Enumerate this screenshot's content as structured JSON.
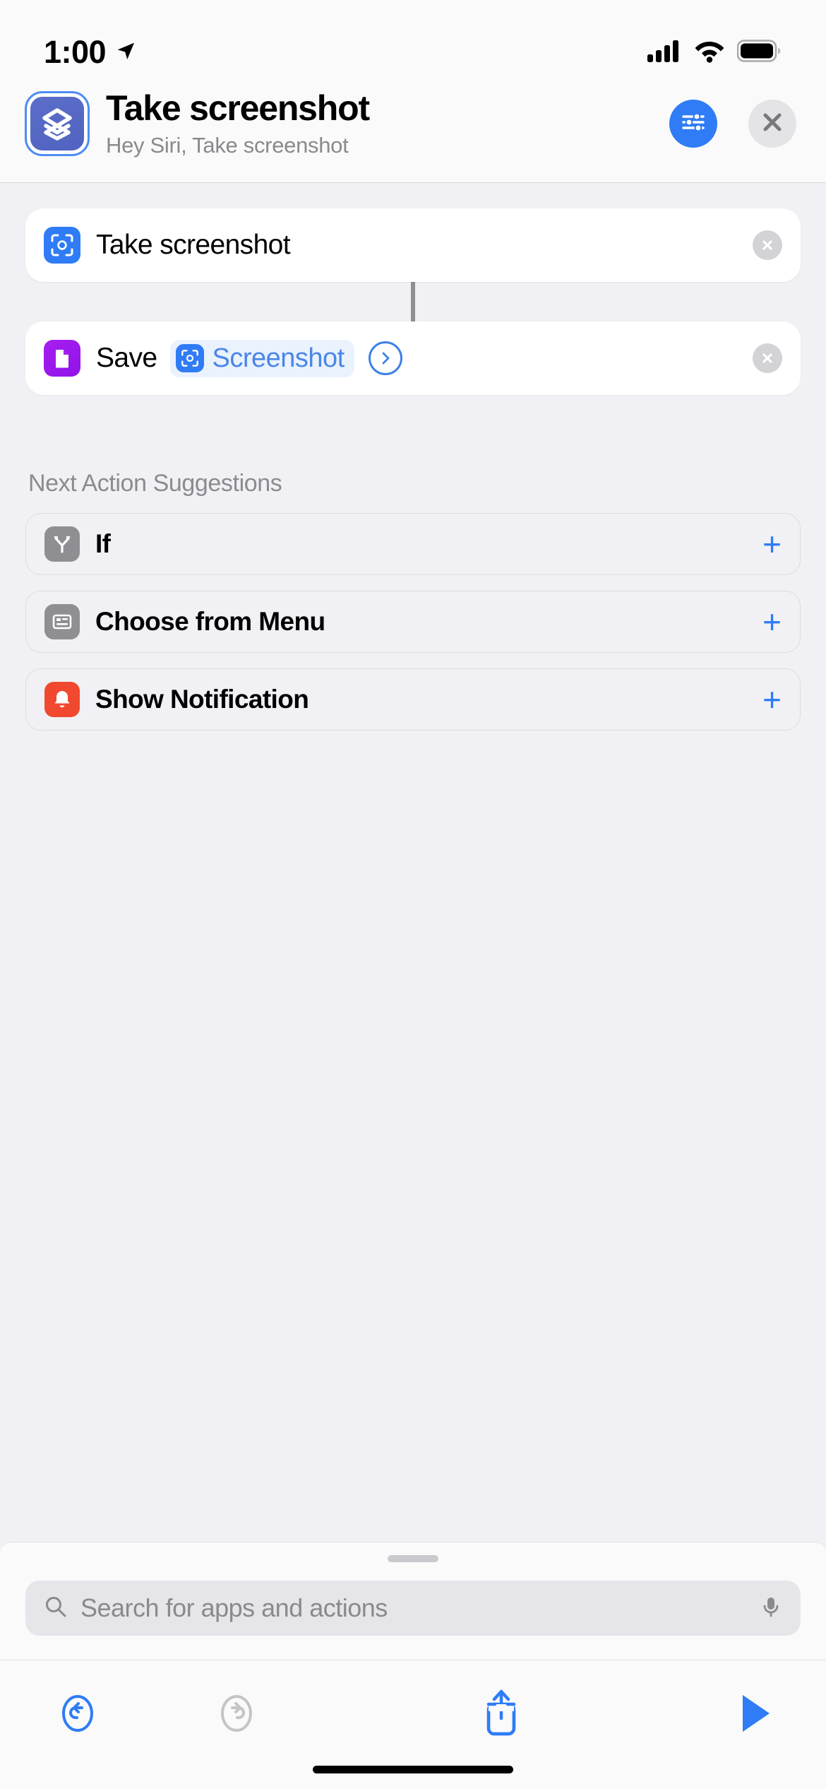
{
  "statusbar": {
    "time": "1:00",
    "location_icon": "location-arrow-icon",
    "cellular_icon": "cellular-bars-icon",
    "wifi_icon": "wifi-icon",
    "battery_icon": "battery-full-icon"
  },
  "header": {
    "icon": "shortcut-layers-icon",
    "title": "Take screenshot",
    "subtitle": "Hey Siri, Take screenshot",
    "settings_button": "sliders-icon",
    "close_button": "close-x-icon",
    "accent_blue": "#2f7cf6",
    "icon_bg": "#5063c0"
  },
  "actions": [
    {
      "icon": "camera-viewfinder-icon",
      "icon_color": "#2f7cf6",
      "label": "Take screenshot",
      "delete_label": "×",
      "has_token": false
    },
    {
      "icon": "document-icon",
      "icon_color": "#9013e8",
      "label": "Save",
      "delete_label": "×",
      "has_token": true,
      "token": {
        "icon": "camera-viewfinder-icon",
        "label": "Screenshot"
      },
      "chevron": "chevron-right-icon"
    }
  ],
  "suggestions": {
    "title": "Next Action Suggestions",
    "items": [
      {
        "icon": "branch-icon",
        "icon_color": "#8e8e93",
        "label": "If",
        "add_label": "+"
      },
      {
        "icon": "menu-list-icon",
        "icon_color": "#8e8e93",
        "label": "Choose from Menu",
        "add_label": "+"
      },
      {
        "icon": "notification-bell-icon",
        "icon_color": "#f0492f",
        "label": "Show Notification",
        "add_label": "+"
      }
    ]
  },
  "sheet": {
    "grabber": "drag-handle",
    "search": {
      "placeholder": "Search for apps and actions",
      "value": "",
      "search_icon": "search-icon",
      "mic_icon": "microphone-icon"
    },
    "toolbar": [
      {
        "icon": "undo-icon",
        "color": "#2f7cf6",
        "enabled": true
      },
      {
        "icon": "redo-icon",
        "color": "#c4c4c8",
        "enabled": false
      },
      {
        "icon": "share-icon",
        "color": "#2f7cf6",
        "enabled": true
      },
      {
        "icon": "play-icon",
        "color": "#2f7cf6",
        "enabled": true
      }
    ]
  }
}
